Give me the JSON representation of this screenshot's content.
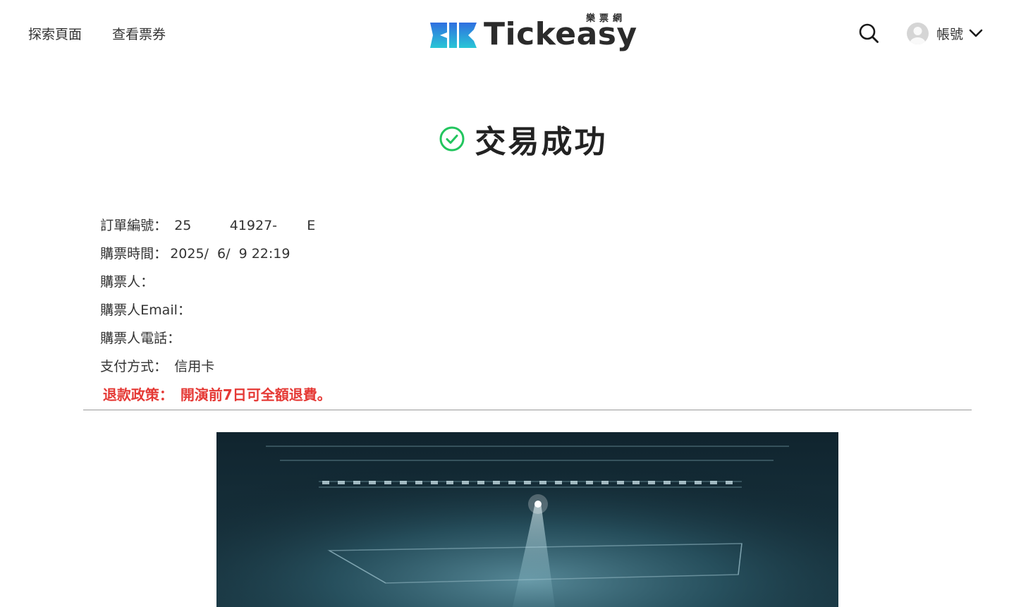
{
  "header": {
    "nav": [
      {
        "label": "探索頁面"
      },
      {
        "label": "查看票券"
      }
    ],
    "logo": {
      "text": "Tickeasy",
      "subtext": "樂票網"
    },
    "search_icon": "search-icon",
    "account": {
      "label": "帳號",
      "icon": "chevron-down-icon"
    }
  },
  "page": {
    "title": "交易成功",
    "title_icon": "check-circle-icon",
    "accent_color": "#22c55e"
  },
  "order": {
    "rows": [
      {
        "label": "訂單編號：",
        "value": "25         41927-       E"
      },
      {
        "label": "購票時間：",
        "value": "2025/  6/  9 22:19"
      },
      {
        "label": "購票人：",
        "value": ""
      },
      {
        "label": "購票人Email：",
        "value": ""
      },
      {
        "label": "購票人電話：",
        "value": ""
      },
      {
        "label": "支付方式：",
        "value": "信用卡"
      }
    ],
    "refund": {
      "label": "退款政策：",
      "value": "開演前7日可全額退費。",
      "color": "#e53935"
    }
  }
}
